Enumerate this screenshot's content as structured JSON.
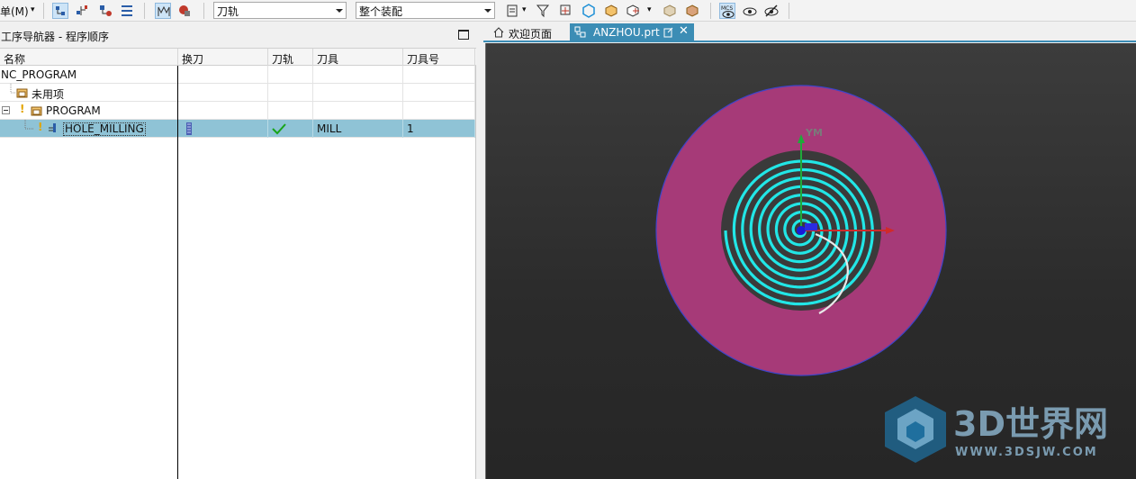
{
  "toolbar": {
    "menu_label": "单(M)",
    "combo_toolpath": "刀轨",
    "combo_assembly": "整个装配"
  },
  "navigator": {
    "title": "工序导航器 - 程序顺序",
    "columns": [
      "名称",
      "换刀",
      "刀轨",
      "刀具",
      "刀具号"
    ],
    "rows": [
      {
        "name": "NC_PROGRAM",
        "tool_change": "",
        "path": "",
        "tool": "",
        "tool_no": ""
      },
      {
        "name": "未用项",
        "tool_change": "",
        "path": "",
        "tool": "",
        "tool_no": ""
      },
      {
        "name": "PROGRAM",
        "tool_change": "",
        "path": "",
        "tool": "",
        "tool_no": ""
      },
      {
        "name": "HOLE_MILLING",
        "tool_change": "",
        "path": "",
        "tool": "MILL",
        "tool_no": "1"
      }
    ]
  },
  "tabs": {
    "welcome": "欢迎页面",
    "part": "ANZHOU.prt"
  },
  "viewport": {
    "axis_y_label": "YM",
    "colors": {
      "outer_disk": "#a63a78",
      "hole": "#3a3a3a",
      "spiral": "#22e6e6"
    }
  },
  "watermark": {
    "brand": "3D世界网",
    "url": "WWW.3DSJW.COM"
  }
}
